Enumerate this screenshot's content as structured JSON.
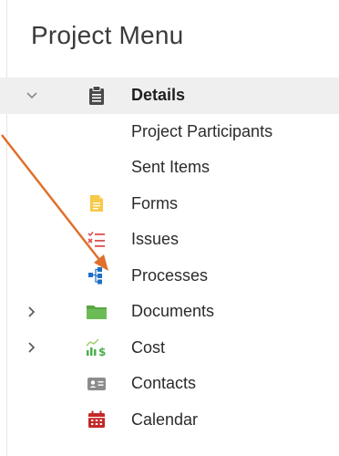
{
  "panel": {
    "title": "Project Menu"
  },
  "menu": {
    "items": [
      {
        "label": "Details",
        "icon": "clipboard-icon",
        "expander": "expanded",
        "selected": true
      },
      {
        "label": "Project Participants",
        "icon": "",
        "expander": "none",
        "selected": false
      },
      {
        "label": "Sent Items",
        "icon": "",
        "expander": "none",
        "selected": false
      },
      {
        "label": "Forms",
        "icon": "forms-icon",
        "expander": "none",
        "selected": false
      },
      {
        "label": "Issues",
        "icon": "issues-list-icon",
        "expander": "none",
        "selected": false
      },
      {
        "label": "Processes",
        "icon": "processes-icon",
        "expander": "none",
        "selected": false
      },
      {
        "label": "Documents",
        "icon": "folder-icon",
        "expander": "collapsed",
        "selected": false
      },
      {
        "label": "Cost",
        "icon": "cost-chart-icon",
        "expander": "collapsed",
        "selected": false
      },
      {
        "label": "Contacts",
        "icon": "contact-card-icon",
        "expander": "none",
        "selected": false
      },
      {
        "label": "Calendar",
        "icon": "calendar-icon",
        "expander": "none",
        "selected": false
      }
    ]
  },
  "colors": {
    "selected_row_bg": "#efefef",
    "forms_icon": "#f7c948",
    "issues_icon": "#d9534f",
    "processes_icon": "#1e6fc6",
    "documents_icon": "#5aa544",
    "cost_icon": "#4caf50",
    "contacts_icon": "#8c8c8c",
    "calendar_icon": "#c62828",
    "annotation_arrow": "#e0702b"
  }
}
